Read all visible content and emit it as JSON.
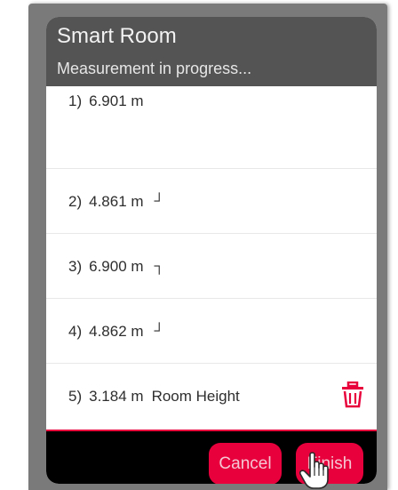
{
  "dialog": {
    "title": "Smart Room",
    "subtitle": "Measurement in progress..."
  },
  "measurements": [
    {
      "index": "1)",
      "value": "6.901 m",
      "corner": "",
      "label": ""
    },
    {
      "index": "2)",
      "value": "4.861 m",
      "corner": "┘",
      "label": ""
    },
    {
      "index": "3)",
      "value": "6.900 m",
      "corner": "┐",
      "label": ""
    },
    {
      "index": "4)",
      "value": "4.862 m",
      "corner": "┘",
      "label": ""
    },
    {
      "index": "5)",
      "value": "3.184 m",
      "corner": "",
      "label": "Room Height"
    }
  ],
  "footer": {
    "cancel_label": "Cancel",
    "finish_label": "Finish"
  },
  "icons": {
    "delete": "trash-icon",
    "pointer": "hand-pointer-icon"
  },
  "colors": {
    "accent": "#e8003d",
    "header_bg": "#545454",
    "footer_bg": "#000000"
  }
}
